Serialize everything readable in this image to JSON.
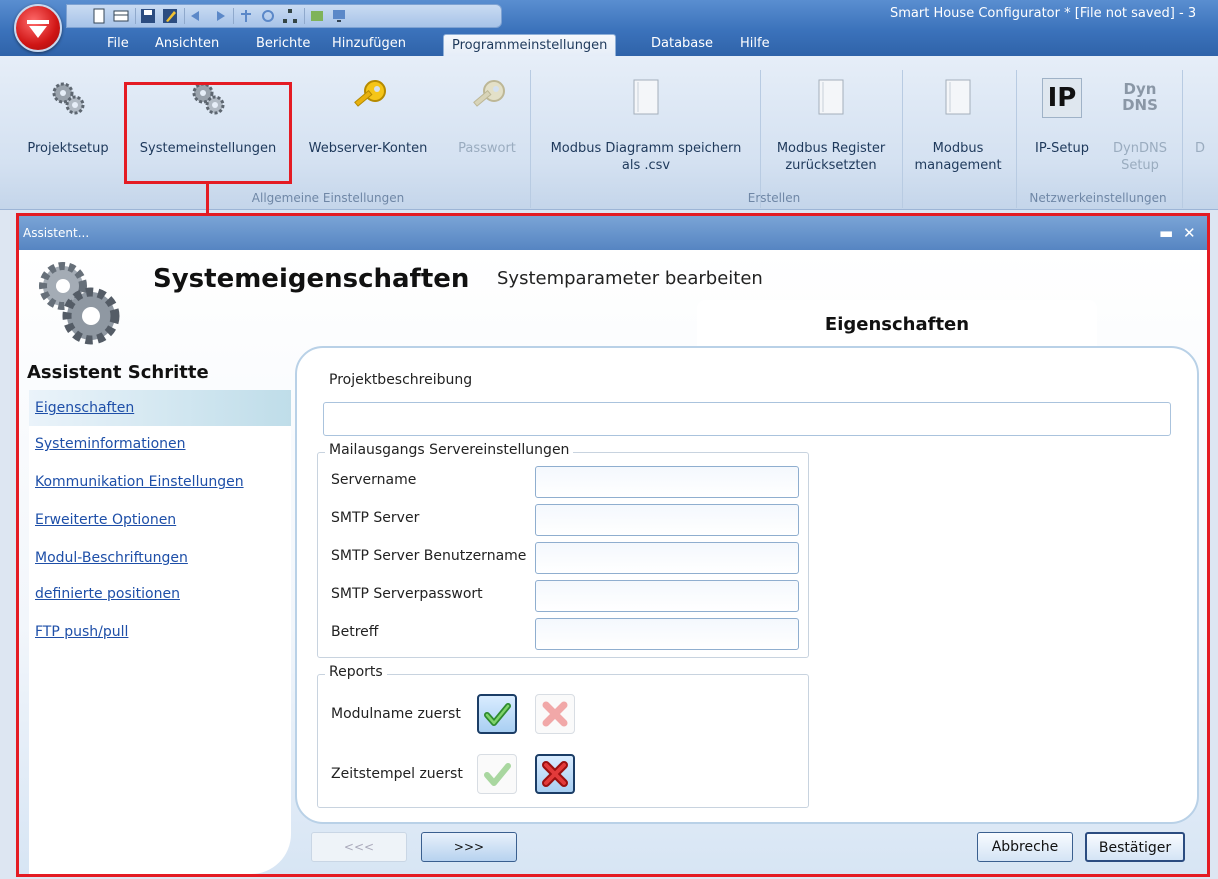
{
  "window": {
    "title": "Smart House Configurator * [File not saved] - 3"
  },
  "menu": {
    "items": [
      "File",
      "Ansichten",
      "Berichte",
      "Hinzufügen",
      "Programmeinstellungen",
      "Database",
      "Hilfe"
    ],
    "active": "Programmeinstellungen"
  },
  "ribbon": {
    "buttons": {
      "projektsetup": "Projektsetup",
      "systemeinstellungen": "Systemeinstellungen",
      "webserver": "Webserver-Konten",
      "passwort": "Passwort",
      "modbus_csv_1": "Modbus Diagramm speichern",
      "modbus_csv_2": "als .csv",
      "modbus_reset_1": "Modbus Register",
      "modbus_reset_2": "zurücksetzten",
      "modbus_mgmt_1": "Modbus",
      "modbus_mgmt_2": "management",
      "ip_setup": "IP-Setup",
      "dyndns_1": "DynDNS",
      "dyndns_2": "Setup",
      "cut": "D"
    },
    "icon_text": {
      "ip": "IP",
      "dyn_1": "Dyn",
      "dyn_2": "DNS"
    },
    "groups": {
      "allgemein": "Allgemeine Einstellungen",
      "erstellen": "Erstellen",
      "netzwerk": "Netzwerkeinstellungen"
    }
  },
  "dialog": {
    "title": "Assistent...",
    "heading": "Systemeigenschaften",
    "subheading": "Systemparameter bearbeiten",
    "tab": "Eigenschaften",
    "steps_title": "Assistent Schritte",
    "steps": [
      "Eigenschaften",
      "Systeminformationen",
      "Kommunikation Einstellungen",
      "Erweiterte Optionen",
      "Modul-Beschriftungen",
      "definierte positionen",
      "FTP push/pull"
    ],
    "projekt_label": "Projektbeschreibung",
    "projekt_value": "",
    "mail_group": "Mailausgangs Servereinstellungen",
    "mail_fields": [
      {
        "label": "Servername",
        "value": ""
      },
      {
        "label": "SMTP Server",
        "value": ""
      },
      {
        "label": "SMTP Server Benutzername",
        "value": ""
      },
      {
        "label": "SMTP Serverpasswort",
        "value": ""
      },
      {
        "label": "Betreff",
        "value": ""
      }
    ],
    "reports_group": "Reports",
    "reports": [
      {
        "label": "Modulname zuerst",
        "selected": "yes"
      },
      {
        "label": "Zeitstempel zuerst",
        "selected": "no"
      }
    ],
    "buttons": {
      "prev": "<<<",
      "next": ">>>",
      "cancel": "Abbreche",
      "confirm": "Bestätiger"
    }
  },
  "colors": {
    "highlight": "#e41b23",
    "link": "#1e4fa8"
  }
}
